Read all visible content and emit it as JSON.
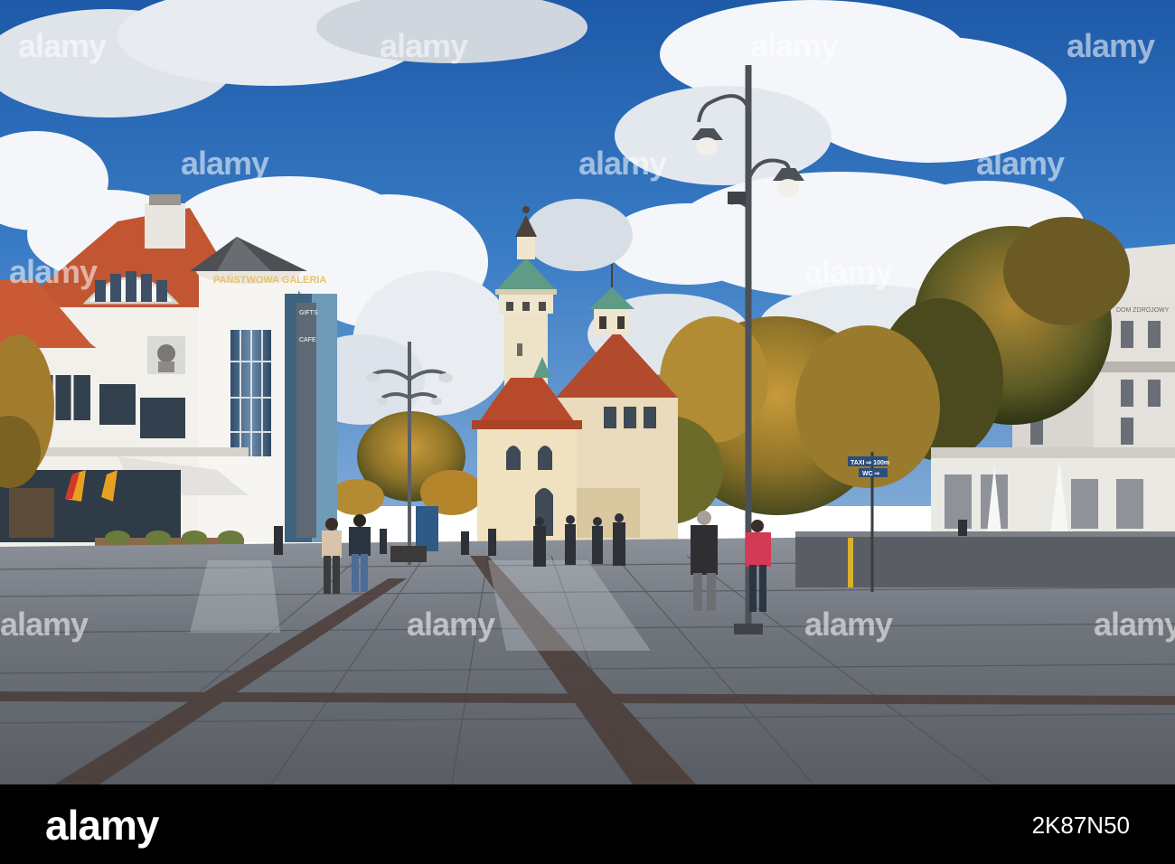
{
  "photo": {
    "building_sign": "PAŃSTWOWA GALERIA",
    "facade_labels": [
      "GIFTS",
      "CAFE"
    ],
    "right_building_sign": "DOM ZDROJOWY",
    "street_sign_1": "TAXI ⇨ 100m",
    "street_sign_2": "WC ⇨"
  },
  "watermark": {
    "text": "alamy"
  },
  "footer": {
    "logo": "alamy",
    "image_id": "2K87N50"
  }
}
